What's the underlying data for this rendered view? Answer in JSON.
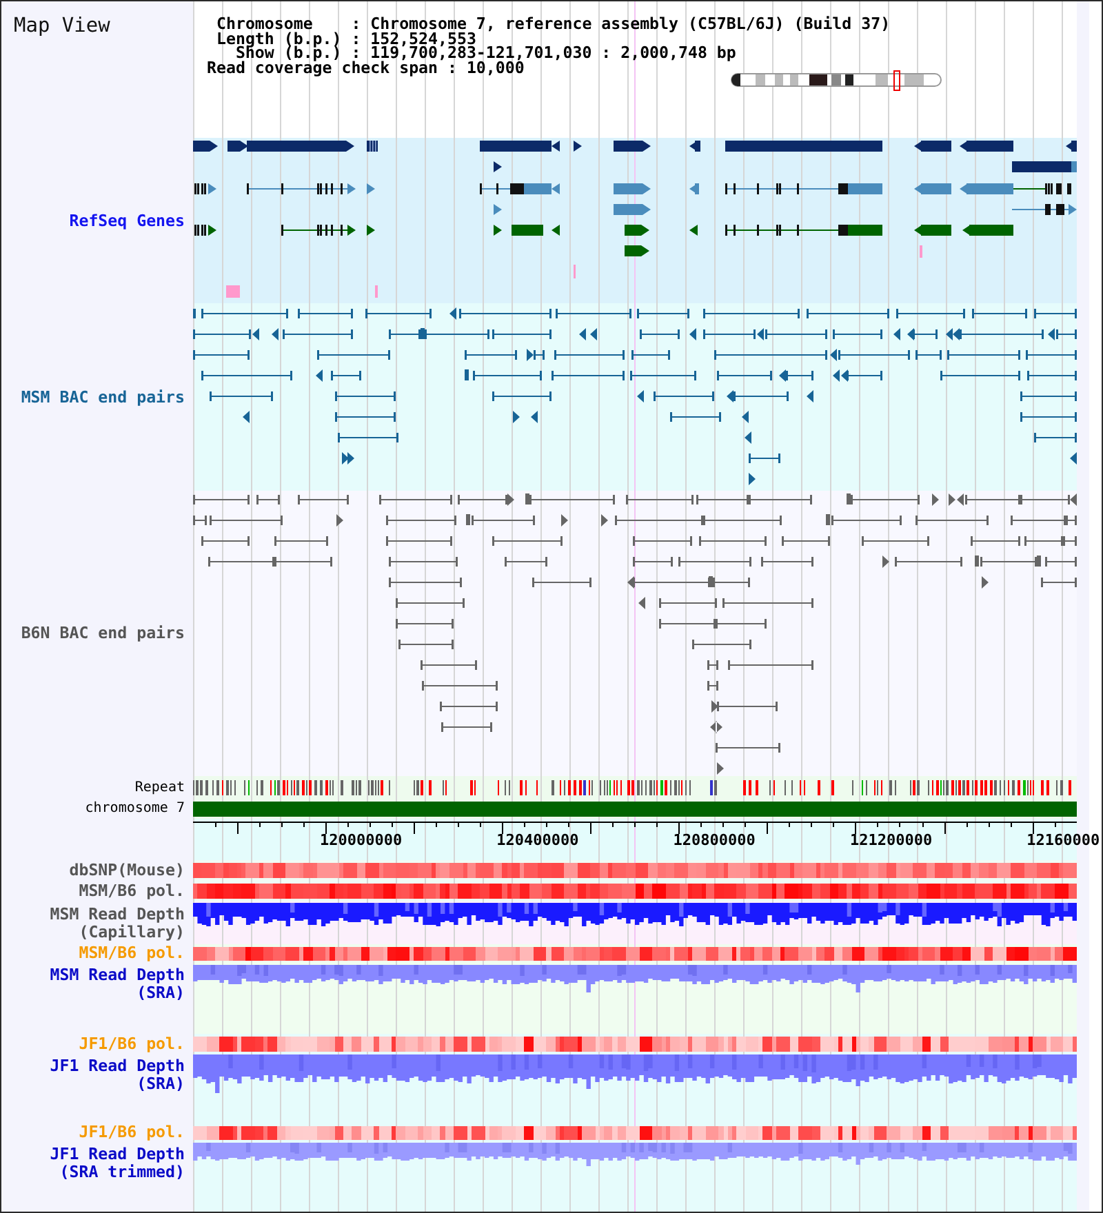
{
  "header": {
    "title": "Map View",
    "info": [
      {
        "label": "Chromosome",
        "separator": ":",
        "value": "Chromosome 7, reference assembly (C57BL/6J) (Build 37)"
      },
      {
        "label": "Length (b.p.)",
        "separator": ":",
        "value": "152,524,553"
      },
      {
        "label": "Show (b.p.)",
        "separator": ":",
        "value": "119,700,283-121,701,030 : 2,000,748 bp"
      },
      {
        "label": "Read coverage check span",
        "separator": ":",
        "value": "10,000"
      }
    ]
  },
  "tracks": [
    {
      "kind": "genes",
      "label": "RefSeq Genes",
      "color": "#1414f0"
    },
    {
      "kind": "pairs",
      "label": "MSM BAC end pairs",
      "color": "#176496"
    },
    {
      "kind": "pairs",
      "label": "B6N BAC end pairs",
      "color": "#555555"
    },
    {
      "kind": "repeats",
      "label": "Repeat",
      "color": "#000000"
    },
    {
      "kind": "chromosome",
      "label": "chromosome 7",
      "color": "#000000"
    },
    {
      "kind": "axis",
      "tick_labels": [
        "120000000",
        "120400000",
        "120800000",
        "121200000",
        "12160000"
      ]
    },
    {
      "kind": "heatmap",
      "label": "dbSNP(Mouse)",
      "color": "#555555"
    },
    {
      "kind": "heatmap",
      "label": "MSM/B6 pol.",
      "color": "#555555"
    },
    {
      "kind": "depth",
      "label": "MSM Read Depth (Capillary)",
      "color": "#555555"
    },
    {
      "kind": "heatmap",
      "label": "MSM/B6 pol.",
      "color": "#f59a00"
    },
    {
      "kind": "depth",
      "label": "MSM Read Depth (SRA)",
      "color": "#0b0bc8"
    },
    {
      "kind": "heatmap",
      "label": "JF1/B6 pol.",
      "color": "#f59a00"
    },
    {
      "kind": "depth",
      "label": "JF1 Read Depth (SRA)",
      "color": "#0b0bc8"
    },
    {
      "kind": "heatmap",
      "label": "JF1/B6 pol.",
      "color": "#f59a00"
    },
    {
      "kind": "depth",
      "label": "JF1 Read Depth (SRA trimmed)",
      "color": "#0b0bc8"
    }
  ]
}
